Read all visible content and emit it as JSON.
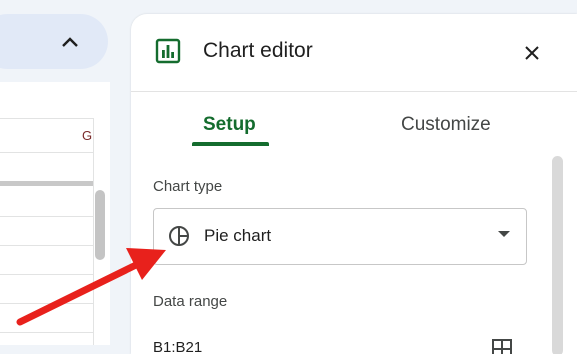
{
  "sheet": {
    "column_header": "G"
  },
  "panel": {
    "title": "Chart editor",
    "tabs": [
      {
        "label": "Setup",
        "active": true
      },
      {
        "label": "Customize",
        "active": false
      }
    ],
    "chart_type": {
      "label": "Chart type",
      "selected": "Pie chart",
      "icon": "pie-chart-icon"
    },
    "data_range": {
      "label": "Data range",
      "value": "B1:B21"
    }
  },
  "colors": {
    "accent": "#146c2e",
    "annotation_arrow": "#e8211c"
  }
}
